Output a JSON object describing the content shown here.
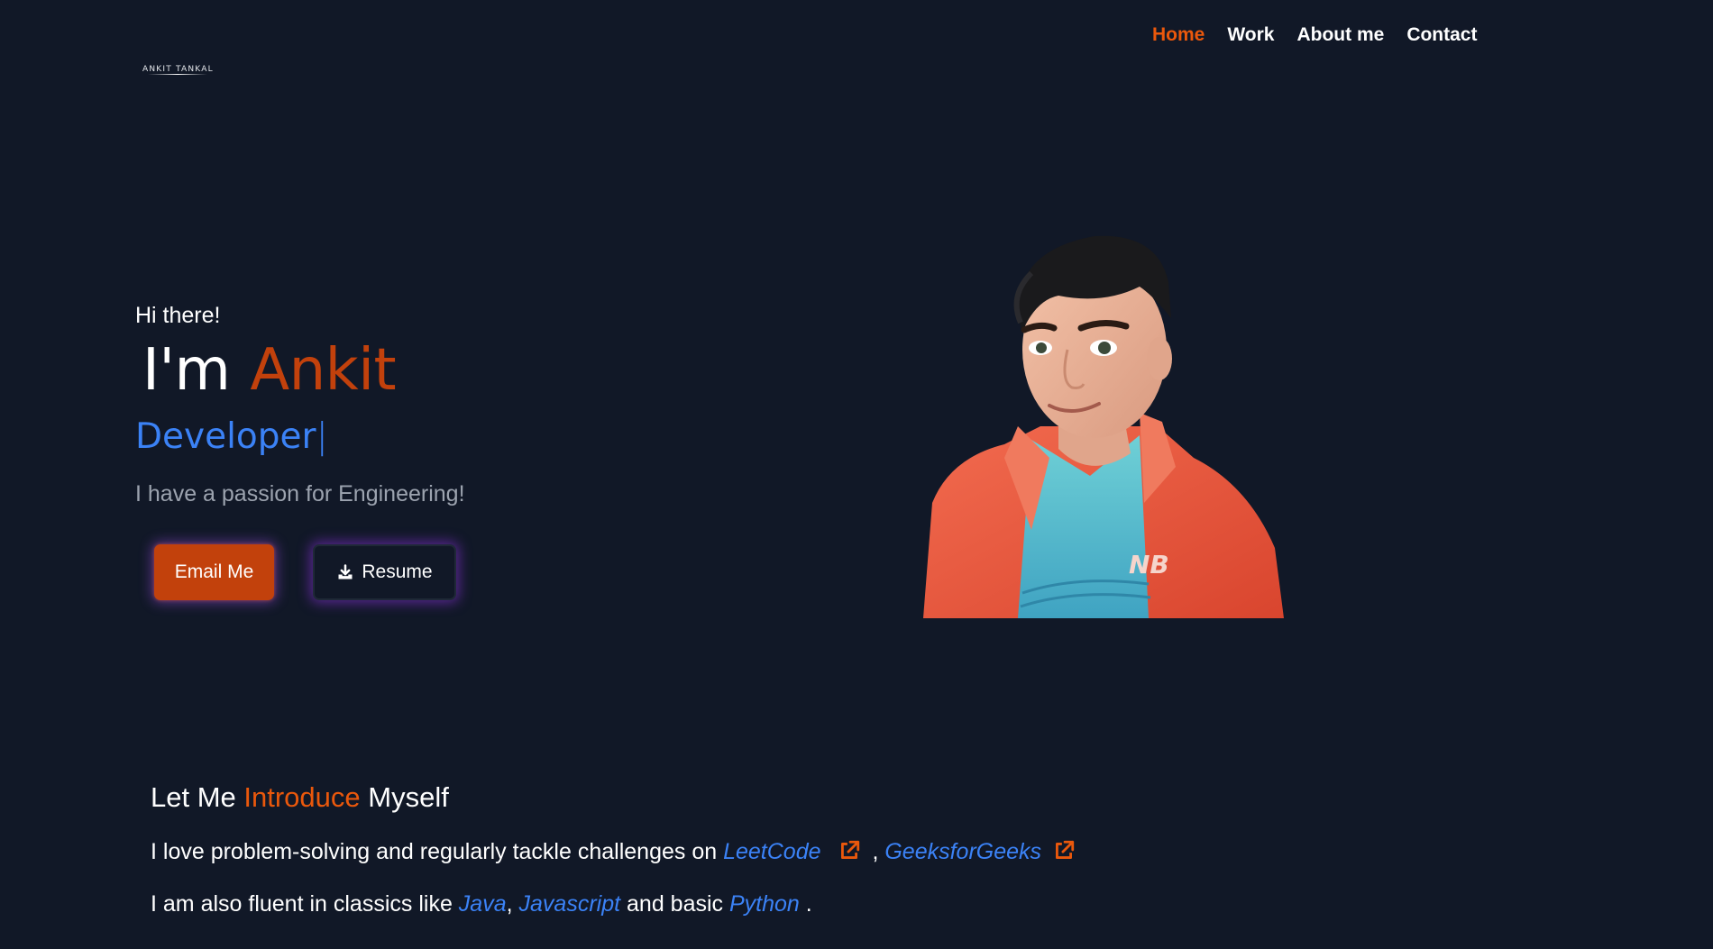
{
  "logo": {
    "text": "ANKIT TANKAL"
  },
  "nav": {
    "items": [
      {
        "label": "Home",
        "active": true
      },
      {
        "label": "Work",
        "active": false
      },
      {
        "label": "About me",
        "active": false
      },
      {
        "label": "Contact",
        "active": false
      }
    ]
  },
  "hero": {
    "greeting": "Hi there!",
    "im": "I'm",
    "name": "Ankit",
    "role": "Developer",
    "cursor": "|",
    "tagline": "I have a passion for Engineering!",
    "email_button": "Email Me",
    "resume_button": "Resume",
    "resume_icon": "download-icon"
  },
  "intro": {
    "title_start": "Let Me ",
    "title_accent": "Introduce",
    "title_end": " Myself",
    "line1_prefix": "I love problem-solving and regularly tackle challenges on ",
    "leetcode": "LeetCode",
    "separator": " , ",
    "geeksforgeeks": "GeeksforGeeks",
    "line2_prefix": "I am also fluent in classics like ",
    "java": "Java",
    "comma": ", ",
    "javascript": "Javascript",
    "and_basic": " and basic ",
    "python": "Python",
    "period": " ."
  },
  "colors": {
    "background": "#111827",
    "accent_orange": "#c2410c",
    "accent_blue": "#3b82f6",
    "muted_text": "#9ca3af"
  }
}
